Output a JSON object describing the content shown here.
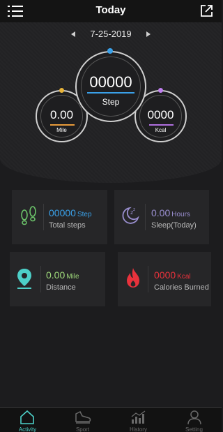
{
  "header": {
    "title": "Today"
  },
  "date": {
    "value": "7-25-2019"
  },
  "rings": {
    "steps": {
      "value": "00000",
      "label": "Step"
    },
    "mile": {
      "value": "0.00",
      "label": "Mile"
    },
    "kcal": {
      "value": "0000",
      "label": "Kcal"
    }
  },
  "cards": {
    "total_steps": {
      "value": "00000",
      "unit": "Step",
      "label": "Total steps"
    },
    "sleep": {
      "value": "0.00",
      "unit": "Hours",
      "label": "Sleep(Today)"
    },
    "distance": {
      "value": "0.00",
      "unit": "Mile",
      "label": "Distance"
    },
    "calories": {
      "value": "0000",
      "unit": "Kcal",
      "label": "Calories Burned"
    }
  },
  "tabs": [
    {
      "label": "Activity",
      "icon": "home-icon"
    },
    {
      "label": "Sport",
      "icon": "shoe-icon"
    },
    {
      "label": "History",
      "icon": "bar-chart-icon"
    },
    {
      "label": "Setting",
      "icon": "user-icon"
    }
  ],
  "colors": {
    "steps": "#3aa0e8",
    "sleep": "#8e7fd0",
    "distance": "#4dd0c8",
    "calories": "#e8323c",
    "mile_accent": "#e89a3a",
    "kcal_accent": "#b070e0"
  }
}
